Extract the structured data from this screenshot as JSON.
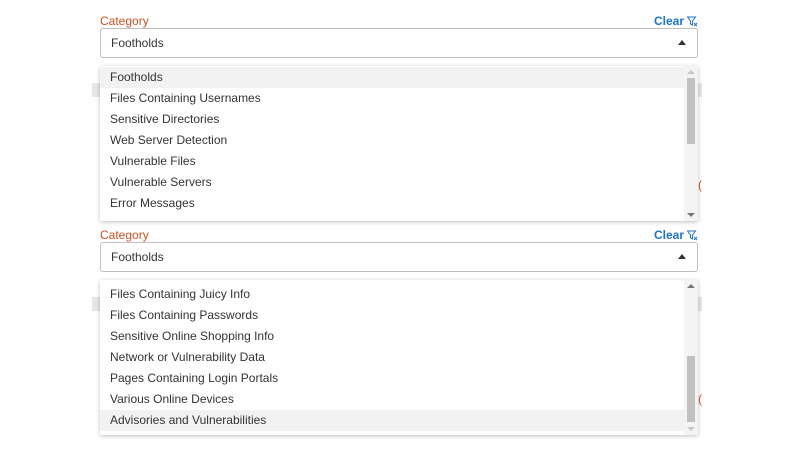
{
  "panels": [
    {
      "label": "Category",
      "clear_label": "Clear",
      "selected_value": "Footholds",
      "options": [
        "Footholds",
        "Files Containing Usernames",
        "Sensitive Directories",
        "Web Server Detection",
        "Vulnerable Files",
        "Vulnerable Servers",
        "Error Messages"
      ],
      "highlighted_option": "Footholds"
    },
    {
      "label": "Category",
      "clear_label": "Clear",
      "selected_value": "Footholds",
      "options": [
        "Files Containing Juicy Info",
        "Files Containing Passwords",
        "Sensitive Online Shopping Info",
        "Network or Vulnerability Data",
        "Pages Containing Login Portals",
        "Various Online Devices",
        "Advisories and Vulnerabilities"
      ],
      "highlighted_option": "Advisories and Vulnerabilities"
    }
  ],
  "colors": {
    "label": "#c8511f",
    "clear": "#1f73c8",
    "highlight": "#f2f2f2",
    "scroll_thumb": "#c1c1c1"
  },
  "icons": {
    "clear": "filter-clear-icon",
    "select_caret": "caret-up-icon"
  }
}
